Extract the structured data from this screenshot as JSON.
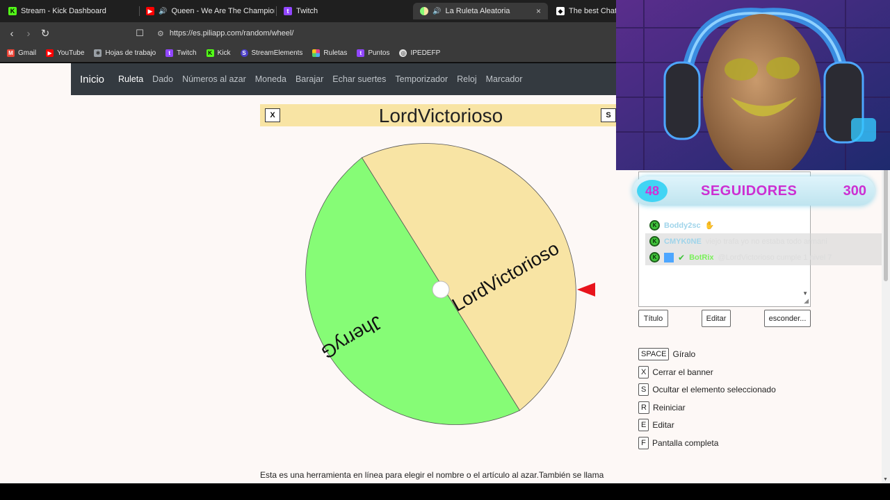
{
  "browser": {
    "tabs": [
      {
        "title": "Stream - Kick Dashboard",
        "icon": "kick-icon",
        "color": "#53fc18"
      },
      {
        "title": "Queen - We Are The Champions (",
        "icon": "youtube-icon",
        "color": "#ff0000"
      },
      {
        "title": "Twitch",
        "icon": "twitch-icon",
        "color": "#9146ff"
      },
      {
        "title": "La Ruleta Aleatoria",
        "icon": "wheel-icon",
        "color": "#6c63ff"
      },
      {
        "title": "The best ChatBo",
        "icon": "chatbot-icon",
        "color": "#ffffff"
      }
    ],
    "close_glyph": "×",
    "url": "https://es.piliapp.com/random/wheel/",
    "bookmarks": [
      {
        "label": "Gmail",
        "icon": "gmail-icon",
        "color": "#ea4335"
      },
      {
        "label": "YouTube",
        "icon": "youtube-icon",
        "color": "#ff0000"
      },
      {
        "label": "Hojas de trabajo",
        "icon": "puzzle-icon",
        "color": "#9aa0a6"
      },
      {
        "label": "Twitch",
        "icon": "twitch-icon",
        "color": "#9146ff"
      },
      {
        "label": "Kick",
        "icon": "kick-icon",
        "color": "#53fc18"
      },
      {
        "label": "StreamElements",
        "icon": "streamelements-icon",
        "color": "#4b3ec7"
      },
      {
        "label": "Ruletas",
        "icon": "ruletas-icon",
        "color": "#e83e8c"
      },
      {
        "label": "Puntos",
        "icon": "twitch-icon",
        "color": "#9146ff"
      },
      {
        "label": "IPEDEFP",
        "icon": "globe-icon",
        "color": "#dddddd"
      }
    ]
  },
  "nav": {
    "brand": "Inicio",
    "items": [
      "Ruleta",
      "Dado",
      "Números al azar",
      "Moneda",
      "Barajar",
      "Echar suertes",
      "Temporizador",
      "Reloj",
      "Marcador"
    ],
    "active": "Ruleta"
  },
  "banner": {
    "title": "LordVictorioso",
    "close_key": "X",
    "hide_key": "S"
  },
  "wheel": {
    "segments": [
      {
        "label": "LordVictorioso",
        "color": "#f8e4a4"
      },
      {
        "label": "JherryG",
        "color": "#86fc76"
      }
    ],
    "pointer_color": "#e8141c"
  },
  "followers": {
    "count": "48",
    "label": "SEGUIDORES",
    "goal": "300"
  },
  "chat": [
    {
      "user": "Boddy2sc",
      "message": "",
      "user_color": "#9fd4ea",
      "emote": "hand-emote"
    },
    {
      "user": "CMYK0NE",
      "message": "viejo trafa yo no estaba todo armani",
      "user_color": "#9fd4ea",
      "emote": ""
    },
    {
      "user": "BotRix",
      "message": "@LordVictorioso cumple 1 nivel 7",
      "user_color": "#7af05a",
      "emote": ""
    }
  ],
  "buttons": {
    "title": "Título",
    "edit": "Editar",
    "hide": "esconder..."
  },
  "shortcuts": [
    {
      "key": "SPACE",
      "label": "Gíralo"
    },
    {
      "key": "X",
      "label": "Cerrar el banner"
    },
    {
      "key": "S",
      "label": "Ocultar el elemento seleccionado"
    },
    {
      "key": "R",
      "label": "Reiniciar"
    },
    {
      "key": "E",
      "label": "Editar"
    },
    {
      "key": "F",
      "label": "Pantalla completa"
    }
  ],
  "footer_text": "Esta es una herramienta en línea para elegir el nombre o el artículo al azar.También se llama"
}
